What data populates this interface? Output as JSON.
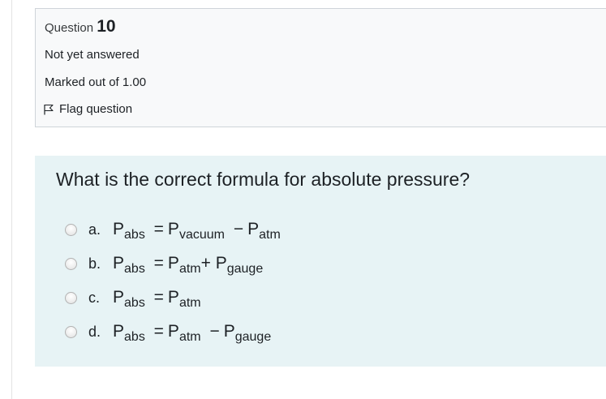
{
  "info": {
    "question_label": "Question",
    "question_number": "10",
    "state": "Not yet answered",
    "grade": "Marked out of 1.00",
    "flag_label": "Flag question"
  },
  "question": {
    "text": "What is the correct formula for absolute pressure?",
    "answers": [
      {
        "letter": "a.",
        "lhs": "P",
        "lhs_sub": "abs",
        "eq": "=",
        "t1": "P",
        "t1_sub": "vacuum",
        "op": "−",
        "t2": "P",
        "t2_sub": "atm",
        "selected": false
      },
      {
        "letter": "b.",
        "lhs": "P",
        "lhs_sub": "abs",
        "eq": "=",
        "t1": "P",
        "t1_sub": "atm",
        "op": "+",
        "t2": "P",
        "t2_sub": "gauge",
        "selected": false
      },
      {
        "letter": "c.",
        "lhs": "P",
        "lhs_sub": "abs",
        "eq": "=",
        "t1": "P",
        "t1_sub": "atm",
        "selected": false
      },
      {
        "letter": "d.",
        "lhs": "P",
        "lhs_sub": "abs",
        "eq": "=",
        "t1": "P",
        "t1_sub": "atm",
        "op": "−",
        "t2": "P",
        "t2_sub": "gauge",
        "selected": false
      }
    ]
  }
}
